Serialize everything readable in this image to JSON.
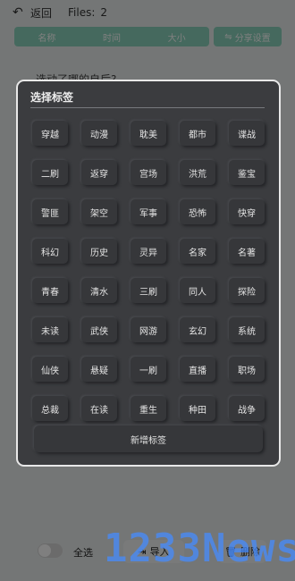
{
  "topbar": {
    "back_icon": "↶",
    "back_label": "返回",
    "files_label": "Files:",
    "files_count": "2"
  },
  "sort_bar": {
    "name": "名称",
    "time": "时间",
    "size": "大小"
  },
  "share_button": {
    "icon": "share-icon",
    "label": "分享设置"
  },
  "background_question": "选动了哪的自后?",
  "bottom_bar": {
    "select_all": "全选",
    "import": "导入",
    "delete": "删除"
  },
  "dialog": {
    "title": "选择标签",
    "tags": [
      "穿越",
      "动漫",
      "耽美",
      "都市",
      "谍战",
      "二刷",
      "返穿",
      "宫场",
      "洪荒",
      "鉴宝",
      "警匪",
      "架空",
      "军事",
      "恐怖",
      "快穿",
      "科幻",
      "历史",
      "灵异",
      "名家",
      "名著",
      "青春",
      "清水",
      "三刷",
      "同人",
      "探险",
      "未读",
      "武侠",
      "网游",
      "玄幻",
      "系统",
      "仙侠",
      "悬疑",
      "一刷",
      "直播",
      "职场",
      "总裁",
      "在读",
      "重生",
      "种田",
      "战争"
    ],
    "add_tag": "新增标签"
  },
  "watermark": "1233News"
}
